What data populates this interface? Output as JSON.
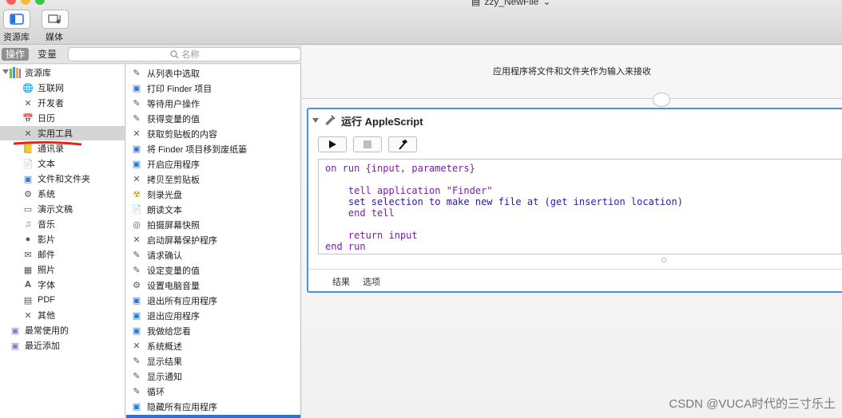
{
  "window": {
    "title": "zzy_NewFile",
    "title_caret": "⌄"
  },
  "toolbar": {
    "library_label": "资源库",
    "media_label": "媒体"
  },
  "tabs": {
    "actions": "操作",
    "variables": "变量"
  },
  "search": {
    "placeholder": "名称",
    "icon": "search-icon"
  },
  "library": {
    "root_label": "资源库",
    "items": [
      {
        "label": "互联网",
        "icon": "globe-icon"
      },
      {
        "label": "开发者",
        "icon": "tools-icon"
      },
      {
        "label": "日历",
        "icon": "calendar-icon"
      },
      {
        "label": "实用工具",
        "icon": "tools-icon",
        "selected": true
      },
      {
        "label": "通讯录",
        "icon": "contacts-icon"
      },
      {
        "label": "文本",
        "icon": "text-icon"
      },
      {
        "label": "文件和文件夹",
        "icon": "finder-icon"
      },
      {
        "label": "系统",
        "icon": "system-icon"
      },
      {
        "label": "演示文稿",
        "icon": "keynote-icon"
      },
      {
        "label": "音乐",
        "icon": "music-icon"
      },
      {
        "label": "影片",
        "icon": "movie-icon"
      },
      {
        "label": "邮件",
        "icon": "mail-icon"
      },
      {
        "label": "照片",
        "icon": "photos-icon"
      },
      {
        "label": "字体",
        "icon": "font-icon"
      },
      {
        "label": "PDF",
        "icon": "pdf-icon"
      },
      {
        "label": "其他",
        "icon": "tools-icon"
      }
    ],
    "smart_groups": [
      {
        "label": "最常使用的",
        "icon": "folder-icon"
      },
      {
        "label": "最近添加",
        "icon": "folder-icon"
      }
    ]
  },
  "actions": [
    {
      "label": "从列表中选取",
      "icon": "script-icon"
    },
    {
      "label": "打印 Finder 项目",
      "icon": "finder-icon"
    },
    {
      "label": "等待用户操作",
      "icon": "script-icon"
    },
    {
      "label": "获得变量的值",
      "icon": "script-icon"
    },
    {
      "label": "获取剪贴板的内容",
      "icon": "tools-icon"
    },
    {
      "label": "将 Finder 项目移到废纸篓",
      "icon": "finder-icon"
    },
    {
      "label": "开启应用程序",
      "icon": "finder-icon"
    },
    {
      "label": "拷贝至剪贴板",
      "icon": "tools-icon"
    },
    {
      "label": "刻录光盘",
      "icon": "burn-icon"
    },
    {
      "label": "朗读文本",
      "icon": "text-icon"
    },
    {
      "label": "拍摄屏幕快照",
      "icon": "camera-icon"
    },
    {
      "label": "启动屏幕保护程序",
      "icon": "tools-icon"
    },
    {
      "label": "请求确认",
      "icon": "script-icon"
    },
    {
      "label": "设定变量的值",
      "icon": "script-icon"
    },
    {
      "label": "设置电脑音量",
      "icon": "system-icon"
    },
    {
      "label": "退出所有应用程序",
      "icon": "finder-icon"
    },
    {
      "label": "退出应用程序",
      "icon": "finder-icon"
    },
    {
      "label": "我做给您看",
      "icon": "finder-icon"
    },
    {
      "label": "系统概述",
      "icon": "tools-icon"
    },
    {
      "label": "显示结果",
      "icon": "script-icon"
    },
    {
      "label": "显示通知",
      "icon": "script-icon"
    },
    {
      "label": "循环",
      "icon": "script-icon"
    },
    {
      "label": "隐藏所有应用程序",
      "icon": "finder-icon"
    }
  ],
  "workflow": {
    "receives": "应用程序将文件和文件夹作为输入来接收",
    "action_title": "运行 AppleScript",
    "code": [
      {
        "text": "on run {input, parameters}",
        "kw": true
      },
      {
        "text": "",
        "kw": false
      },
      {
        "text": "    tell application \"Finder\"",
        "kw": true
      },
      {
        "text": "    set selection to make new file at (get insertion location)",
        "kw": false
      },
      {
        "text": "    end tell",
        "kw": true
      },
      {
        "text": "",
        "kw": false
      },
      {
        "text": "    return input",
        "kw": true
      },
      {
        "text": "end run",
        "kw": true
      }
    ],
    "footer": {
      "results": "结果",
      "options": "选项"
    }
  },
  "watermark": "CSDN @VUCA时代的三寸乐土",
  "colors": {
    "accent": "#4d8ee8",
    "selection_underline": "#e0271b"
  }
}
